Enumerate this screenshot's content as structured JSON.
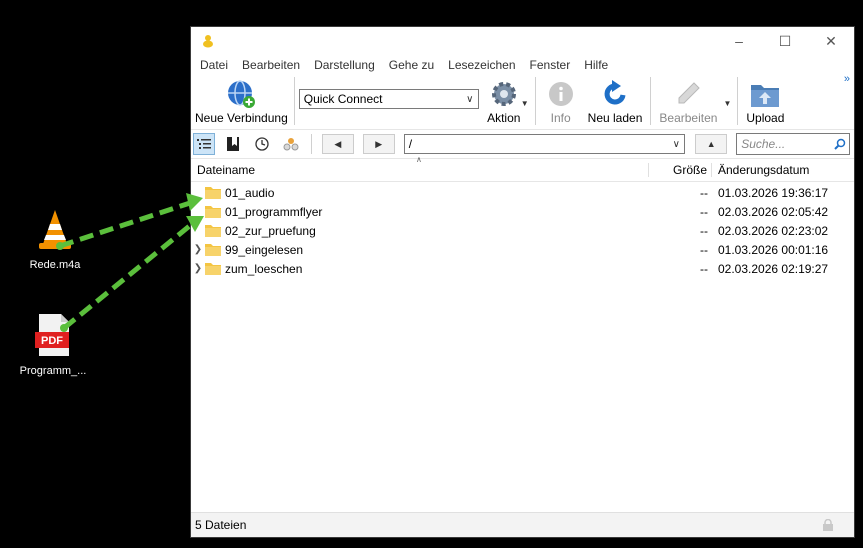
{
  "desktop": {
    "icons": [
      {
        "label": "Rede.m4a"
      },
      {
        "label": "Programm_..."
      }
    ]
  },
  "window": {
    "menu": [
      "Datei",
      "Bearbeiten",
      "Darstellung",
      "Gehe zu",
      "Lesezeichen",
      "Fenster",
      "Hilfe"
    ],
    "toolbar": {
      "new_connection": "Neue Verbindung",
      "quick_connect": "Quick Connect",
      "action": "Aktion",
      "info": "Info",
      "reload": "Neu laden",
      "edit": "Bearbeiten",
      "upload": "Upload"
    },
    "path": "/",
    "search_placeholder": "Suche...",
    "columns": {
      "name": "Dateiname",
      "size": "Größe",
      "date": "Änderungsdatum"
    },
    "files": [
      {
        "name": "01_audio",
        "size": "--",
        "date": "01.03.2026 19:36:17"
      },
      {
        "name": "01_programmflyer",
        "size": "--",
        "date": "02.03.2026 02:05:42"
      },
      {
        "name": "02_zur_pruefung",
        "size": "--",
        "date": "02.03.2026 02:23:02"
      },
      {
        "name": "99_eingelesen",
        "size": "--",
        "date": "01.03.2026 00:01:16"
      },
      {
        "name": "zum_loeschen",
        "size": "--",
        "date": "02.03.2026 02:19:27"
      }
    ],
    "status": "5 Dateien"
  },
  "colors": {
    "folder": "#f4c542",
    "arrow": "#5bbf3c",
    "accent": "#1e6fc7"
  }
}
